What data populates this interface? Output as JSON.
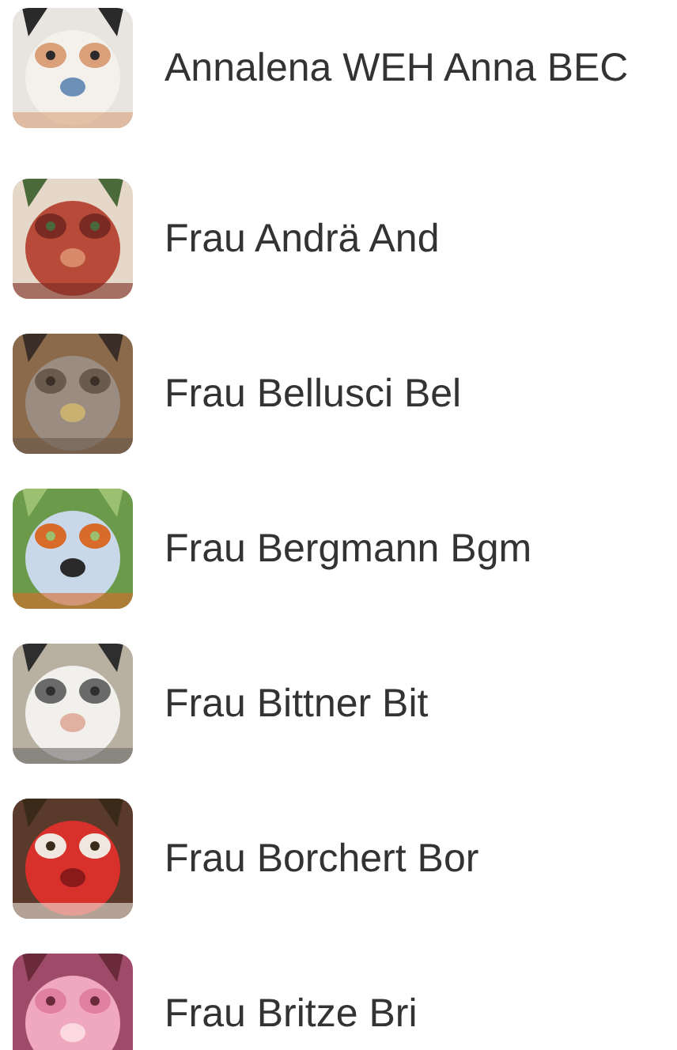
{
  "contacts": [
    {
      "name": "Annalena WEH Anna BEC"
    },
    {
      "name": "Frau Andrä And"
    },
    {
      "name": "Frau Bellusci Bel"
    },
    {
      "name": "Frau Bergmann Bgm"
    },
    {
      "name": "Frau Bittner Bit"
    },
    {
      "name": "Frau Borchert Bor"
    },
    {
      "name": "Frau Britze Bri"
    }
  ]
}
